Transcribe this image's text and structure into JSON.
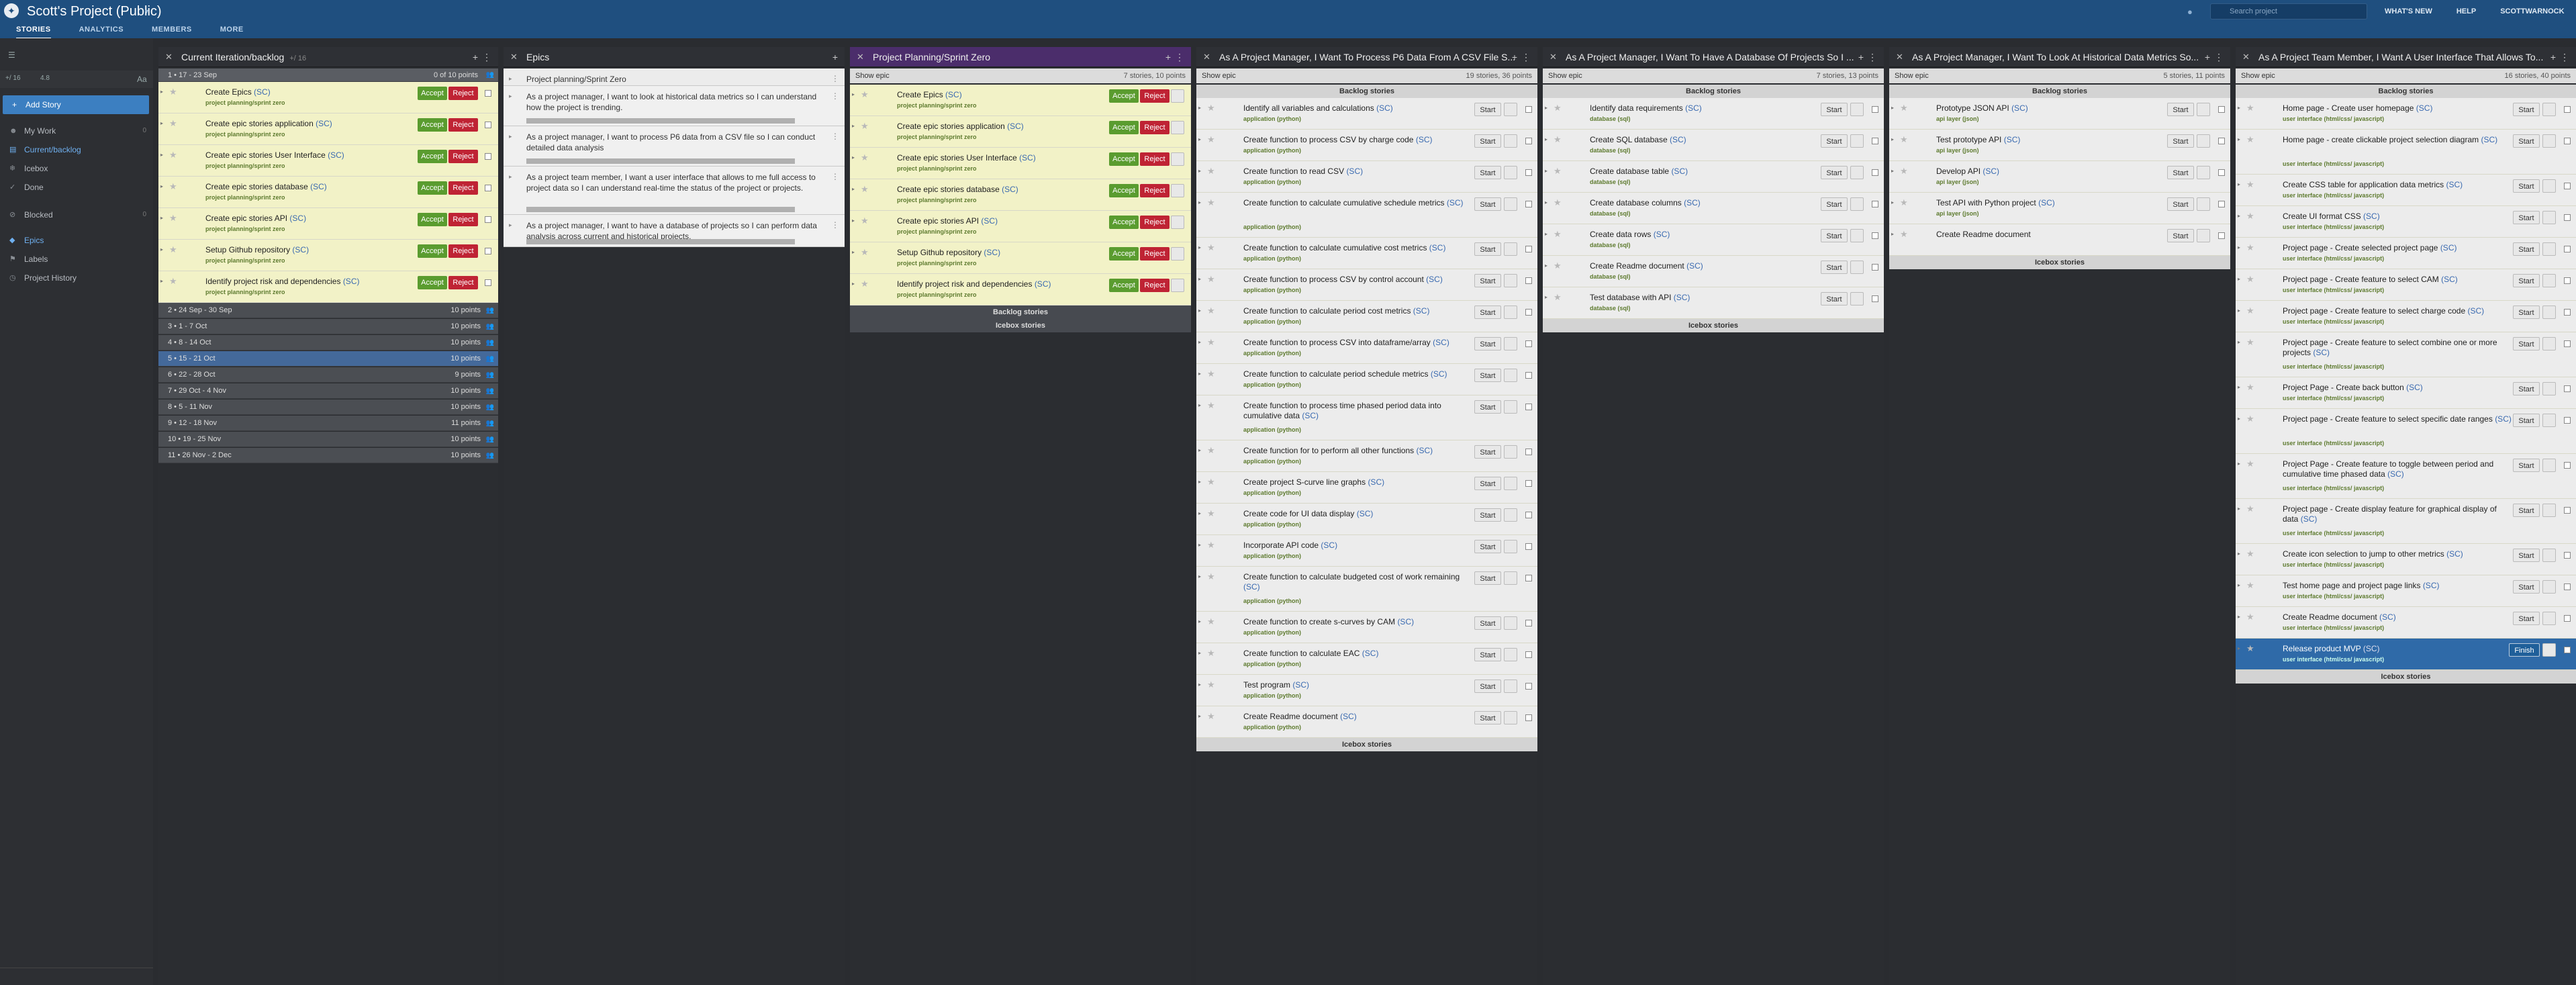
{
  "header": {
    "logo": "✦",
    "title": "Scott's Project (Public)",
    "caret": "▾",
    "tabs": [
      "STORIES",
      "ANALYTICS",
      "MEMBERS",
      "MORE"
    ],
    "bell": "●",
    "search_placeholder": "Search project",
    "search_icon": "⌕",
    "right_links": [
      "WHAT'S NEW",
      "HELP",
      "SCOTTWARNOCK"
    ]
  },
  "sidebar": {
    "add_story": "Add Story",
    "items": [
      {
        "label": "My Work",
        "icon": "☻",
        "count": "0"
      },
      {
        "label": "Current/backlog",
        "icon": "▤",
        "count": ""
      },
      {
        "label": "Icebox",
        "icon": "❄",
        "count": ""
      },
      {
        "label": "Done",
        "icon": "✓",
        "count": ""
      },
      {
        "label": "Blocked",
        "icon": "⊘",
        "count": "0"
      },
      {
        "label": "Epics",
        "icon": "◆",
        "count": ""
      },
      {
        "label": "Labels",
        "icon": "⚑",
        "count": ""
      },
      {
        "label": "Project History",
        "icon": "◷",
        "count": ""
      }
    ],
    "tools_left": "☰",
    "tools_right": "Aa",
    "row2_a": "+/ 16",
    "row2_b": "4.8"
  },
  "panel_current": {
    "title": "Current Iteration/backlog",
    "sub": "+/ 16",
    "iter_head": "1 • 17 - 23 Sep",
    "iter_head_pts": "0 of 10 points",
    "cards": [
      {
        "name": "Create Epics",
        "label": "project planning/sprint zero"
      },
      {
        "name": "Create epic stories application",
        "label": "project planning/sprint zero"
      },
      {
        "name": "Create epic stories User Interface",
        "label": "project planning/sprint zero"
      },
      {
        "name": "Create epic stories database",
        "label": "project planning/sprint zero"
      },
      {
        "name": "Create epic stories API",
        "label": "project planning/sprint zero"
      },
      {
        "name": "Setup Github repository",
        "label": "project planning/sprint zero"
      },
      {
        "name": "Identify project risk and dependencies",
        "label": "project planning/sprint zero"
      }
    ],
    "accept": "Accept",
    "reject": "Reject",
    "sc": "(SC)",
    "iterations": [
      {
        "label": "2 • 24 Sep - 30 Sep",
        "pts": "10 points"
      },
      {
        "label": "3 • 1 - 7 Oct",
        "pts": "10 points"
      },
      {
        "label": "4 • 8 - 14 Oct",
        "pts": "10 points"
      },
      {
        "label": "5 • 15 - 21 Oct",
        "pts": "10 points"
      },
      {
        "label": "6 • 22 - 28 Oct",
        "pts": "9 points"
      },
      {
        "label": "7 • 29 Oct - 4 Nov",
        "pts": "10 points"
      },
      {
        "label": "8 • 5 - 11 Nov",
        "pts": "10 points"
      },
      {
        "label": "9 • 12 - 18 Nov",
        "pts": "11 points"
      },
      {
        "label": "10 • 19 - 25 Nov",
        "pts": "10 points"
      },
      {
        "label": "11 • 26 Nov - 2 Dec",
        "pts": "10 points"
      }
    ]
  },
  "panel_epics": {
    "title": "Epics",
    "items": [
      "Project planning/Sprint Zero",
      "As a project manager, I want to look at historical data metrics so I can understand how the project is trending.",
      "As a project manager, I want to process P6 data from a CSV file so I can conduct detailed data analysis",
      "As a project team member, I want a user interface that allows to me full access to project data so I can understand real-time the status of the project or projects.",
      "As a project manager, I want to have a database of projects so I can perform data analysis across current and historical projects."
    ]
  },
  "panel_sprint": {
    "title": "Project Planning/Sprint Zero",
    "show": "Show epic",
    "count": "7 stories, 10 points",
    "cards": [
      {
        "name": "Create Epics",
        "label": "project planning/sprint zero"
      },
      {
        "name": "Create epic stories application",
        "label": "project planning/sprint zero"
      },
      {
        "name": "Create epic stories User Interface",
        "label": "project planning/sprint zero"
      },
      {
        "name": "Create epic stories database",
        "label": "project planning/sprint zero"
      },
      {
        "name": "Create epic stories API",
        "label": "project planning/sprint zero"
      },
      {
        "name": "Setup Github repository",
        "label": "project planning/sprint zero"
      },
      {
        "name": "Identify project risk and dependencies",
        "label": "project planning/sprint zero"
      }
    ],
    "backlog": "Backlog stories",
    "icebox": "Icebox stories"
  },
  "panel_p6": {
    "title": "As A Project Manager, I Want To Process P6 Data From A CSV File S...",
    "show": "Show epic",
    "count": "19 stories, 36 points",
    "backlog": "Backlog stories",
    "icebox": "Icebox stories",
    "start": "Start",
    "cards": [
      {
        "name": "Identify all variables and calculations",
        "label": "application (python)"
      },
      {
        "name": "Create function to process CSV by charge code",
        "label": "application (python)"
      },
      {
        "name": "Create function to read CSV",
        "label": "application (python)"
      },
      {
        "name": "Create function to calculate cumulative schedule metrics",
        "label": "application (python)",
        "two": true
      },
      {
        "name": "Create function to calculate cumulative cost metrics",
        "label": "application (python)"
      },
      {
        "name": "Create function to process CSV by control account",
        "label": "application (python)"
      },
      {
        "name": "Create function to calculate period cost metrics",
        "label": "application (python)"
      },
      {
        "name": "Create function to process CSV into dataframe/array",
        "label": "application (python)"
      },
      {
        "name": "Create function to calculate period schedule metrics",
        "label": "application (python)"
      },
      {
        "name": "Create function to process time phased period data into cumulative data",
        "label": "application (python)",
        "two": true
      },
      {
        "name": "Create function for to perform all other functions",
        "label": "application (python)"
      },
      {
        "name": "Create project S-curve line graphs",
        "label": "application (python)"
      },
      {
        "name": "Create code for UI data display",
        "label": "application (python)"
      },
      {
        "name": "Incorporate API code",
        "label": "application (python)"
      },
      {
        "name": "Create function to calculate budgeted cost of work remaining",
        "label": "application (python)",
        "two": true
      },
      {
        "name": "Create function to create s-curves by CAM",
        "label": "application (python)"
      },
      {
        "name": "Create function to calculate EAC",
        "label": "application (python)"
      },
      {
        "name": "Test program",
        "label": "application (python)"
      },
      {
        "name": "Create Readme document",
        "label": "application (python)"
      }
    ]
  },
  "panel_db": {
    "title": "As A Project Manager, I Want To Have A Database Of Projects So I ...",
    "show": "Show epic",
    "count": "7 stories, 13 points",
    "backlog": "Backlog stories",
    "icebox": "Icebox stories",
    "start": "Start",
    "cards": [
      {
        "name": "Identify data requirements",
        "label": "database (sql)"
      },
      {
        "name": "Create SQL database",
        "label": "database (sql)"
      },
      {
        "name": "Create database table",
        "label": "database (sql)"
      },
      {
        "name": "Create database columns",
        "label": "database (sql)"
      },
      {
        "name": "Create data rows",
        "label": "database (sql)"
      },
      {
        "name": "Create Readme document",
        "label": "database (sql)"
      },
      {
        "name": "Test database with API",
        "label": "database (sql)"
      }
    ]
  },
  "panel_hist": {
    "title": "As A Project Manager, I Want To Look At Historical Data Metrics So...",
    "show": "Show epic",
    "count": "5 stories, 11 points",
    "backlog": "Backlog stories",
    "icebox": "Icebox stories",
    "start": "Start",
    "cards": [
      {
        "name": "Prototype JSON API",
        "label": "api layer (json)"
      },
      {
        "name": "Test prototype API",
        "label": "api layer (json)"
      },
      {
        "name": "Develop API",
        "label": "api layer (json)"
      },
      {
        "name": "Test API with Python project",
        "label": "api layer (json)"
      },
      {
        "name": "Create Readme document",
        "label": "",
        "nosc": true
      }
    ]
  },
  "panel_ui": {
    "title": "As A Project Team Member, I Want A User Interface That Allows To...",
    "show": "Show epic",
    "count": "16 stories, 40 points",
    "backlog": "Backlog stories",
    "icebox": "Icebox stories",
    "start": "Start",
    "finish": "Finish",
    "cards": [
      {
        "name": "Home page - Create user homepage",
        "label": "user interface (html/css/ javascript)"
      },
      {
        "name": "Home page - create clickable project selection diagram",
        "label": "user interface (html/css/ javascript)",
        "two": true
      },
      {
        "name": "Create CSS table for application data metrics",
        "label": "user interface (html/css/ javascript)"
      },
      {
        "name": "Create UI format CSS",
        "label": "user interface (html/css/ javascript)"
      },
      {
        "name": "Project page - Create selected project page",
        "label": "user interface (html/css/ javascript)"
      },
      {
        "name": "Project page - Create feature to select CAM",
        "label": "user interface (html/css/ javascript)"
      },
      {
        "name": "Project page - Create feature to select charge code",
        "label": "user interface (html/css/ javascript)"
      },
      {
        "name": "Project page - Create feature to select combine one or more projects",
        "label": "user interface (html/css/ javascript)",
        "two": true
      },
      {
        "name": "Project Page - Create back button",
        "label": "user interface (html/css/ javascript)"
      },
      {
        "name": "Project page - Create feature to select specific date ranges",
        "label": "user interface (html/css/ javascript)",
        "two": true
      },
      {
        "name": "Project Page - Create feature to toggle between period and cumulative time phased data",
        "label": "user interface (html/css/ javascript)",
        "two": true
      },
      {
        "name": "Project page - Create display feature for graphical display of data",
        "label": "user interface (html/css/ javascript)",
        "two": true
      },
      {
        "name": "Create icon selection to jump to other metrics",
        "label": "user interface (html/css/ javascript)"
      },
      {
        "name": "Test home page and project page links",
        "label": "user interface (html/css/ javascript)"
      },
      {
        "name": "Create Readme document",
        "label": "user interface (html/css/ javascript)"
      },
      {
        "name": "Release product MVP",
        "label": "user interface (html/css/ javascript)",
        "release": true
      }
    ]
  },
  "icons": {
    "star": "★",
    "arrow": "▸",
    "close": "✕",
    "plus": "+",
    "menu": "⋮",
    "people": "👥"
  },
  "colors": {
    "topbar": "#1f4f7f",
    "accept": "#5a9c2f",
    "reject": "#bf2334",
    "current_card": "#f2f2c7",
    "sprint_header": "#4b2d6b",
    "selected_iteration": "#44699a",
    "release": "#2f6aa8"
  }
}
